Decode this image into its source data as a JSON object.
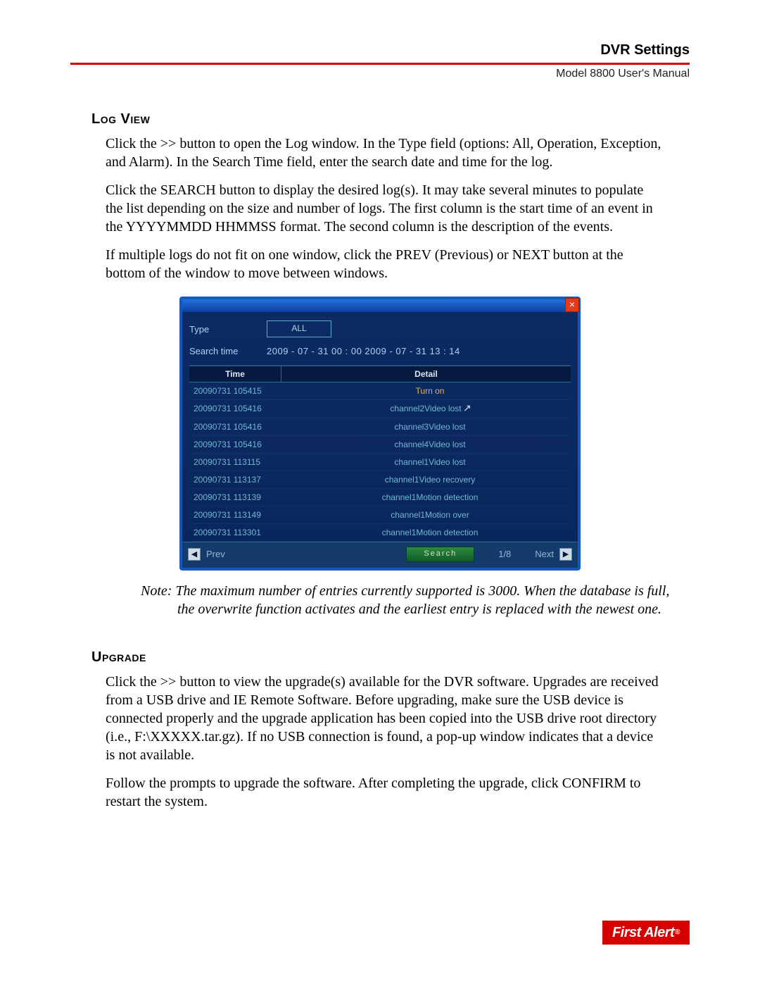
{
  "header": {
    "section_title": "DVR Settings",
    "subtitle": "Model 8800 User's Manual"
  },
  "sections": {
    "log_view": {
      "heading": "Log View",
      "p1": "Click the >> button to open the Log window. In the Type field (options: All, Operation, Exception, and Alarm). In the Search Time field, enter the search date and time for the log.",
      "p2": "Click the SEARCH button to display the desired log(s). It may take several minutes to populate the list depending on the size and number of logs. The first column is the start time of an event in the YYYYMMDD HHMMSS format. The second column is the description of the events.",
      "p3": "If multiple logs do not fit on one window, click the PREV (Previous) or NEXT button at the bottom of the window to move between windows."
    },
    "note": {
      "label": "Note:",
      "text": "The maximum number of entries currently supported is 3000. When the database is full, the overwrite function activates and the earliest entry is replaced with the newest one."
    },
    "upgrade": {
      "heading": "Upgrade",
      "p1": "Click the >> button to view the upgrade(s) available for the DVR software. Upgrades are received from a USB drive and IE Remote Software. Before upgrading, make sure the USB device is connected properly and the upgrade application has been copied into the USB drive root directory (i.e., F:\\XXXXX.tar.gz). If no USB connection is found, a pop-up window indicates that a device is not available.",
      "p2": "Follow the prompts to upgrade the software. After completing the upgrade, click CONFIRM to restart the system."
    }
  },
  "dvr": {
    "close_glyph": "×",
    "labels": {
      "type": "Type",
      "search_time": "Search time",
      "time_col": "Time",
      "detail_col": "Detail",
      "prev": "Prev",
      "next": "Next",
      "search_btn": "Search",
      "page": "1/8"
    },
    "type_value": "ALL",
    "search_time_value": "2009 - 07 - 31   00 : 00       2009 - 07 - 31   13 : 14",
    "rows": [
      {
        "time": "20090731 105415",
        "detail": "Turn on",
        "highlight": true
      },
      {
        "time": "20090731 105416",
        "detail": "channel2Video lost",
        "cursor": true
      },
      {
        "time": "20090731 105416",
        "detail": "channel3Video lost"
      },
      {
        "time": "20090731 105416",
        "detail": "channel4Video lost"
      },
      {
        "time": "20090731 113115",
        "detail": "channel1Video lost"
      },
      {
        "time": "20090731 113137",
        "detail": "channel1Video recovery"
      },
      {
        "time": "20090731 113139",
        "detail": "channel1Motion detection"
      },
      {
        "time": "20090731 113149",
        "detail": "channel1Motion over"
      },
      {
        "time": "20090731 113301",
        "detail": "channel1Motion detection"
      }
    ],
    "nav": {
      "prev_glyph": "◀",
      "next_glyph": "▶"
    }
  },
  "logo": {
    "text": "First Alert",
    "reg": "®"
  }
}
